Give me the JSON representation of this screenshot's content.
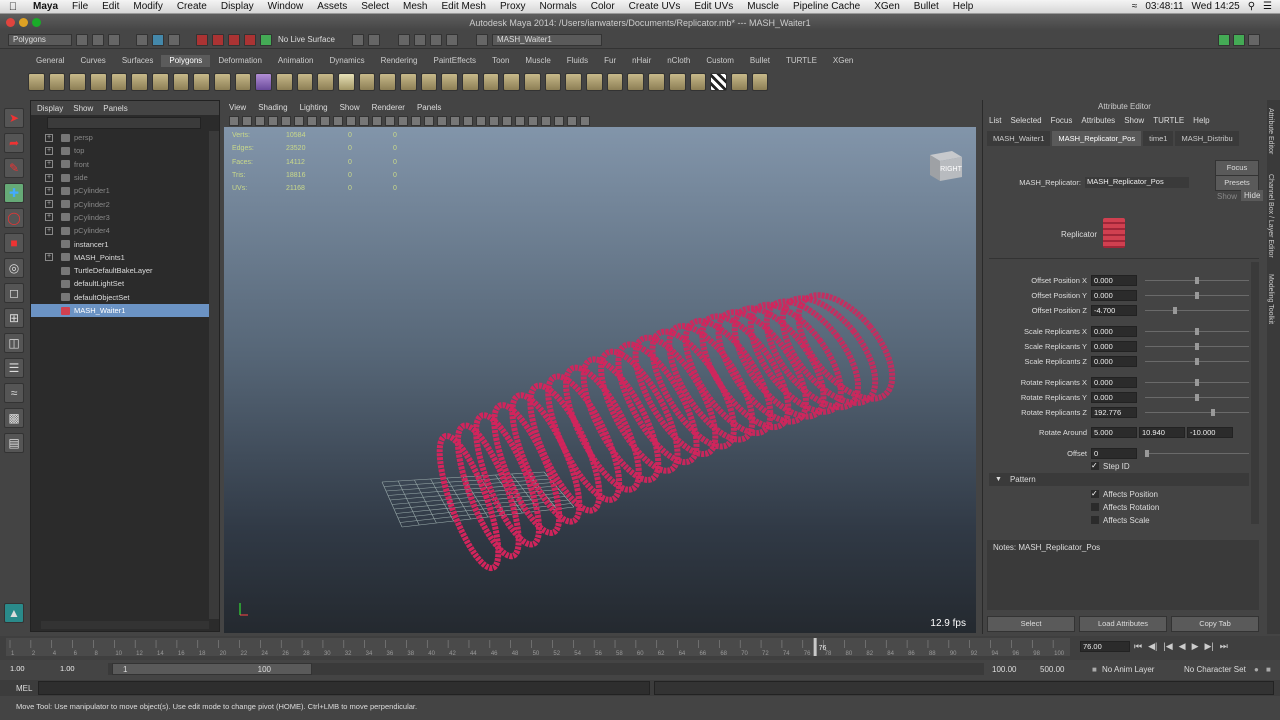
{
  "menubar": {
    "app": "Maya",
    "items": [
      "File",
      "Edit",
      "Modify",
      "Create",
      "Display",
      "Window",
      "Assets",
      "Select",
      "Mesh",
      "Edit Mesh",
      "Proxy",
      "Normals",
      "Color",
      "Create UVs",
      "Edit UVs",
      "Muscle",
      "Pipeline Cache",
      "XGen",
      "Bullet",
      "Help"
    ],
    "clock": "03:48:11",
    "datetime": "Wed 14:25"
  },
  "window_title": "Autodesk Maya 2014: /Users/ianwaters/Documents/Replicator.mb*   ---   MASH_Waiter1",
  "statusline": {
    "mode": "Polygons",
    "live_surface": "No Live Surface",
    "selection_field": "MASH_Waiter1"
  },
  "shelf_tabs": [
    "General",
    "Curves",
    "Surfaces",
    "Polygons",
    "Deformation",
    "Animation",
    "Dynamics",
    "Rendering",
    "PaintEffects",
    "Toon",
    "Muscle",
    "Fluids",
    "Fur",
    "nHair",
    "nCloth",
    "Custom",
    "Bullet",
    "TURTLE",
    "XGen"
  ],
  "active_shelf": "Polygons",
  "outliner": {
    "menu": [
      "Display",
      "Show",
      "Panels"
    ],
    "items": [
      {
        "label": "persp",
        "dim": true,
        "expand": true
      },
      {
        "label": "top",
        "dim": true,
        "expand": true
      },
      {
        "label": "front",
        "dim": true,
        "expand": true
      },
      {
        "label": "side",
        "dim": true,
        "expand": true
      },
      {
        "label": "pCylinder1",
        "dim": true,
        "expand": true
      },
      {
        "label": "pCylinder2",
        "dim": true,
        "expand": true
      },
      {
        "label": "pCylinder3",
        "dim": true,
        "expand": true
      },
      {
        "label": "pCylinder4",
        "dim": true,
        "expand": true
      },
      {
        "label": "instancer1",
        "dim": false,
        "expand": false
      },
      {
        "label": "MASH_Points1",
        "dim": false,
        "expand": true
      },
      {
        "label": "TurtleDefaultBakeLayer",
        "dim": false,
        "expand": false
      },
      {
        "label": "defaultLightSet",
        "dim": false,
        "expand": false
      },
      {
        "label": "defaultObjectSet",
        "dim": false,
        "expand": false
      },
      {
        "label": "MASH_Waiter1",
        "dim": false,
        "expand": false,
        "selected": true
      }
    ]
  },
  "viewport": {
    "menu": [
      "View",
      "Shading",
      "Lighting",
      "Show",
      "Renderer",
      "Panels"
    ],
    "hud": [
      {
        "label": "Verts:",
        "v1": "10584",
        "v2": "0",
        "v3": "0"
      },
      {
        "label": "Edges:",
        "v1": "23520",
        "v2": "0",
        "v3": "0"
      },
      {
        "label": "Faces:",
        "v1": "14112",
        "v2": "0",
        "v3": "0"
      },
      {
        "label": "Tris:",
        "v1": "18816",
        "v2": "0",
        "v3": "0"
      },
      {
        "label": "UVs:",
        "v1": "21168",
        "v2": "0",
        "v3": "0"
      }
    ],
    "viewcube_label": "RIGHT",
    "fps": "12.9 fps",
    "ring_color": "#d4245c"
  },
  "attribute_editor": {
    "title": "Attribute Editor",
    "menu": [
      "List",
      "Selected",
      "Focus",
      "Attributes",
      "Show",
      "TURTLE",
      "Help"
    ],
    "tabs": [
      "MASH_Waiter1",
      "MASH_Replicator_Pos",
      "time1",
      "MASH_Distribu"
    ],
    "active_tab": "MASH_Replicator_Pos",
    "node_label": "MASH_Replicator:",
    "node_value": "MASH_Replicator_Pos",
    "buttons": {
      "focus": "Focus",
      "presets": "Presets",
      "show": "Show",
      "hide": "Hide"
    },
    "replicator_label": "Replicator",
    "fields": [
      {
        "label": "Offset Position X",
        "value": "0.000"
      },
      {
        "label": "Offset Position Y",
        "value": "0.000"
      },
      {
        "label": "Offset Position Z",
        "value": "-4.700"
      },
      {
        "label": "Scale Replicants X",
        "value": "0.000"
      },
      {
        "label": "Scale Replicants Y",
        "value": "0.000"
      },
      {
        "label": "Scale Replicants Z",
        "value": "0.000"
      },
      {
        "label": "Rotate Replicants X",
        "value": "0.000"
      },
      {
        "label": "Rotate Replicants Y",
        "value": "0.000"
      },
      {
        "label": "Rotate Replicants Z",
        "value": "192.776"
      }
    ],
    "rotate_around": {
      "label": "Rotate Around",
      "x": "5.000",
      "y": "10.940",
      "z": "-10.000"
    },
    "offset": {
      "label": "Offset",
      "value": "0"
    },
    "step_id": "Step ID",
    "pattern_section": "Pattern",
    "pattern_checks": [
      {
        "label": "Affects Position",
        "checked": true
      },
      {
        "label": "Affects Rotation",
        "checked": false
      },
      {
        "label": "Affects Scale",
        "checked": false
      }
    ],
    "notes_label": "Notes:  MASH_Replicator_Pos",
    "bottom_buttons": [
      "Select",
      "Load Attributes",
      "Copy Tab"
    ]
  },
  "side_tabs": [
    "Attribute Editor",
    "Channel Box / Layer Editor",
    "Modeling Toolkit"
  ],
  "timeline": {
    "current_frame": "76",
    "current_frame_field": "76.00",
    "tick_numbers": [
      "1",
      "2",
      "4",
      "6",
      "8",
      "10",
      "12",
      "14",
      "16",
      "18",
      "20",
      "22",
      "24",
      "26",
      "28",
      "30",
      "32",
      "34",
      "36",
      "38",
      "40",
      "42",
      "44",
      "46",
      "48",
      "50",
      "52",
      "54",
      "56",
      "58",
      "60",
      "62",
      "64",
      "66",
      "68",
      "70",
      "72",
      "74",
      "76",
      "78",
      "80",
      "82",
      "84",
      "86",
      "88",
      "90",
      "92",
      "94",
      "96",
      "98",
      "100"
    ]
  },
  "range": {
    "start": "1.00",
    "start2": "1.00",
    "inner_start": "1",
    "inner_end": "100",
    "end": "100.00",
    "end2": "500.00",
    "anim_layer": "No Anim Layer",
    "char_set": "No Character Set"
  },
  "cmd_label": "MEL",
  "help_line": "Move Tool: Use manipulator to move object(s). Use edit mode to change pivot (HOME).  Ctrl+LMB to move perpendicular."
}
